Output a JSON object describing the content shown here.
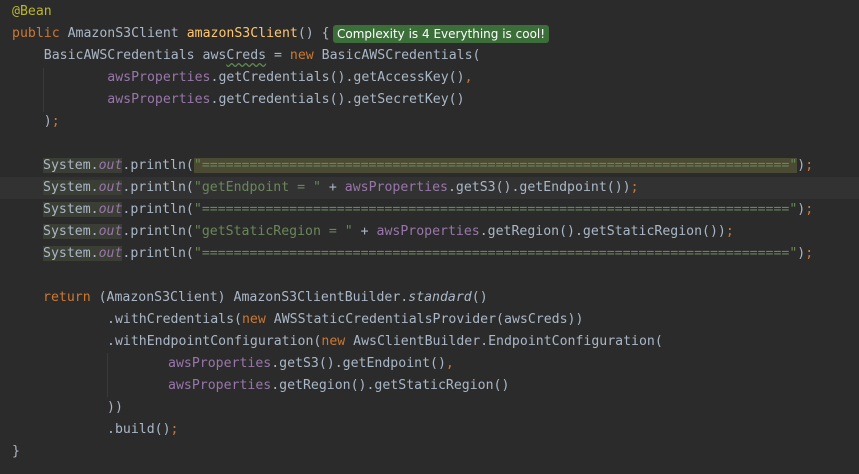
{
  "editor": {
    "badge": "Complexity is 4 Everything is cool!",
    "lines": {
      "l1_ann": "@Bean",
      "l2_public": "public",
      "l2_type": " AmazonS3Client ",
      "l2_fn": "amazonS3Client",
      "l2_rest": "() {",
      "l3_a": "    BasicAWSCredentials aws",
      "l3_creds": "Creds",
      "l3_eq": " = ",
      "l3_new": "new",
      "l3_rest": " BasicAWSCredentials(",
      "l4_ind": "            ",
      "l4_fld": "awsProperties",
      "l4_rest": ".getCredentials().getAccessKey()",
      "l4_comma": ",",
      "l5_ind": "            ",
      "l5_fld": "awsProperties",
      "l5_rest": ".getCredentials().getSecretKey()",
      "l6_close": "    )",
      "l6_semi": ";",
      "l8_sys": "System.",
      "l8_out": "out",
      "l8_print": ".println(",
      "l8_str": "\"==========================================================================\"",
      "l8_end": ")",
      "l8_semi": ";",
      "l9_sys": "System.",
      "l9_out": "out",
      "l9_print": ".println(",
      "l9_str": "\"getEndpoint = \"",
      "l9_plus": " + ",
      "l9_fld": "awsProperties",
      "l9_rest": ".getS3().getEndpoint())",
      "l9_semi": ";",
      "l10_sys": "System.",
      "l10_out": "out",
      "l10_print": ".println(",
      "l10_str": "\"==========================================================================\"",
      "l10_end": ")",
      "l10_semi": ";",
      "l11_sys": "System.",
      "l11_out": "out",
      "l11_print": ".println(",
      "l11_str": "\"getStaticRegion = \"",
      "l11_plus": " + ",
      "l11_fld": "awsProperties",
      "l11_rest": ".getRegion().getStaticRegion())",
      "l11_semi": ";",
      "l12_sys": "System.",
      "l12_out": "out",
      "l12_print": ".println(",
      "l12_str": "\"==========================================================================\"",
      "l12_end": ")",
      "l12_semi": ";",
      "l14_return": "return",
      "l14_a": " (AmazonS3Client) AmazonS3ClientBuilder.",
      "l14_std": "standard",
      "l14_b": "()",
      "l15_a": ".withCredentials(",
      "l15_new": "new",
      "l15_b": " AWSStaticCredentialsProvider(awsCreds))",
      "l16_a": ".withEndpointConfiguration(",
      "l16_new": "new",
      "l16_b": " AwsClientBuilder.EndpointConfiguration(",
      "l17_fld": "awsProperties",
      "l17_rest": ".getS3().getEndpoint()",
      "l17_comma": ",",
      "l18_fld": "awsProperties",
      "l18_rest": ".getRegion().getStaticRegion()",
      "l19": "))",
      "l20_a": ".build()",
      "l20_semi": ";",
      "l21": "}"
    }
  }
}
